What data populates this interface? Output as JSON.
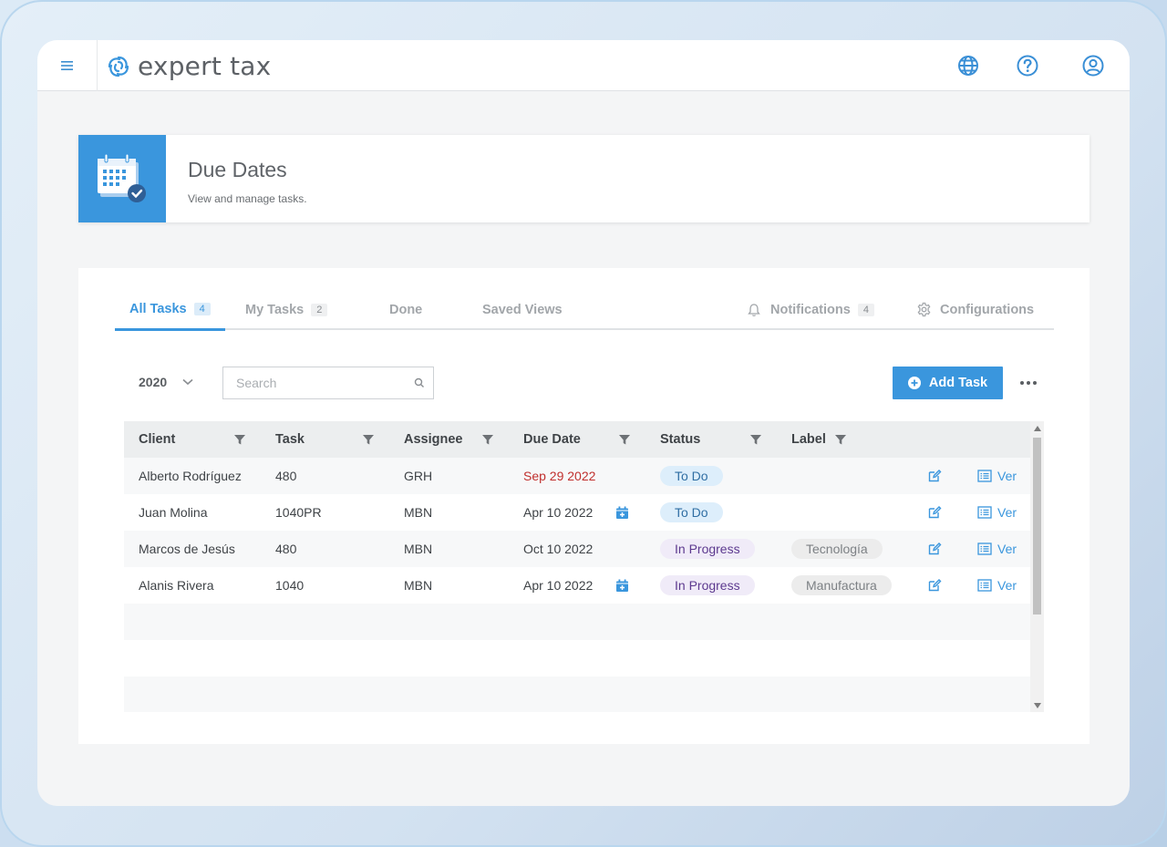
{
  "app": {
    "brand": "expert tax",
    "accent": "#3a96dd"
  },
  "header": {
    "title": "Due Dates",
    "subtitle": "View and manage tasks."
  },
  "tabs": [
    {
      "label": "All Tasks",
      "count": "4",
      "active": true
    },
    {
      "label": "My Tasks",
      "count": "2"
    },
    {
      "label": "Done"
    },
    {
      "label": "Saved Views"
    },
    {
      "label": "Notifications",
      "count": "4",
      "icon": "bell-icon"
    },
    {
      "label": "Configurations",
      "icon": "gear-icon"
    }
  ],
  "toolbar": {
    "year": "2020",
    "search_placeholder": "Search",
    "add_task_label": "Add Task"
  },
  "table": {
    "columns": [
      "Client",
      "Task",
      "Assignee",
      "Due Date",
      "Status",
      "Label"
    ],
    "action_view_label": "Ver",
    "rows": [
      {
        "client": "Alberto Rodríguez",
        "task": "480",
        "assignee": "GRH",
        "due": "Sep 29 2022",
        "overdue": true,
        "calendar": false,
        "status": "To Do",
        "label": ""
      },
      {
        "client": "Juan Molina",
        "task": "1040PR",
        "assignee": "MBN",
        "due": "Apr 10 2022",
        "overdue": false,
        "calendar": true,
        "status": "To Do",
        "label": ""
      },
      {
        "client": "Marcos de Jesús",
        "task": "480",
        "assignee": "MBN",
        "due": "Oct 10 2022",
        "overdue": false,
        "calendar": false,
        "status": "In Progress",
        "label": "Tecnología"
      },
      {
        "client": "Alanis Rivera",
        "task": "1040",
        "assignee": "MBN",
        "due": "Apr 10 2022",
        "overdue": false,
        "calendar": true,
        "status": "In Progress",
        "label": "Manufactura"
      }
    ]
  }
}
